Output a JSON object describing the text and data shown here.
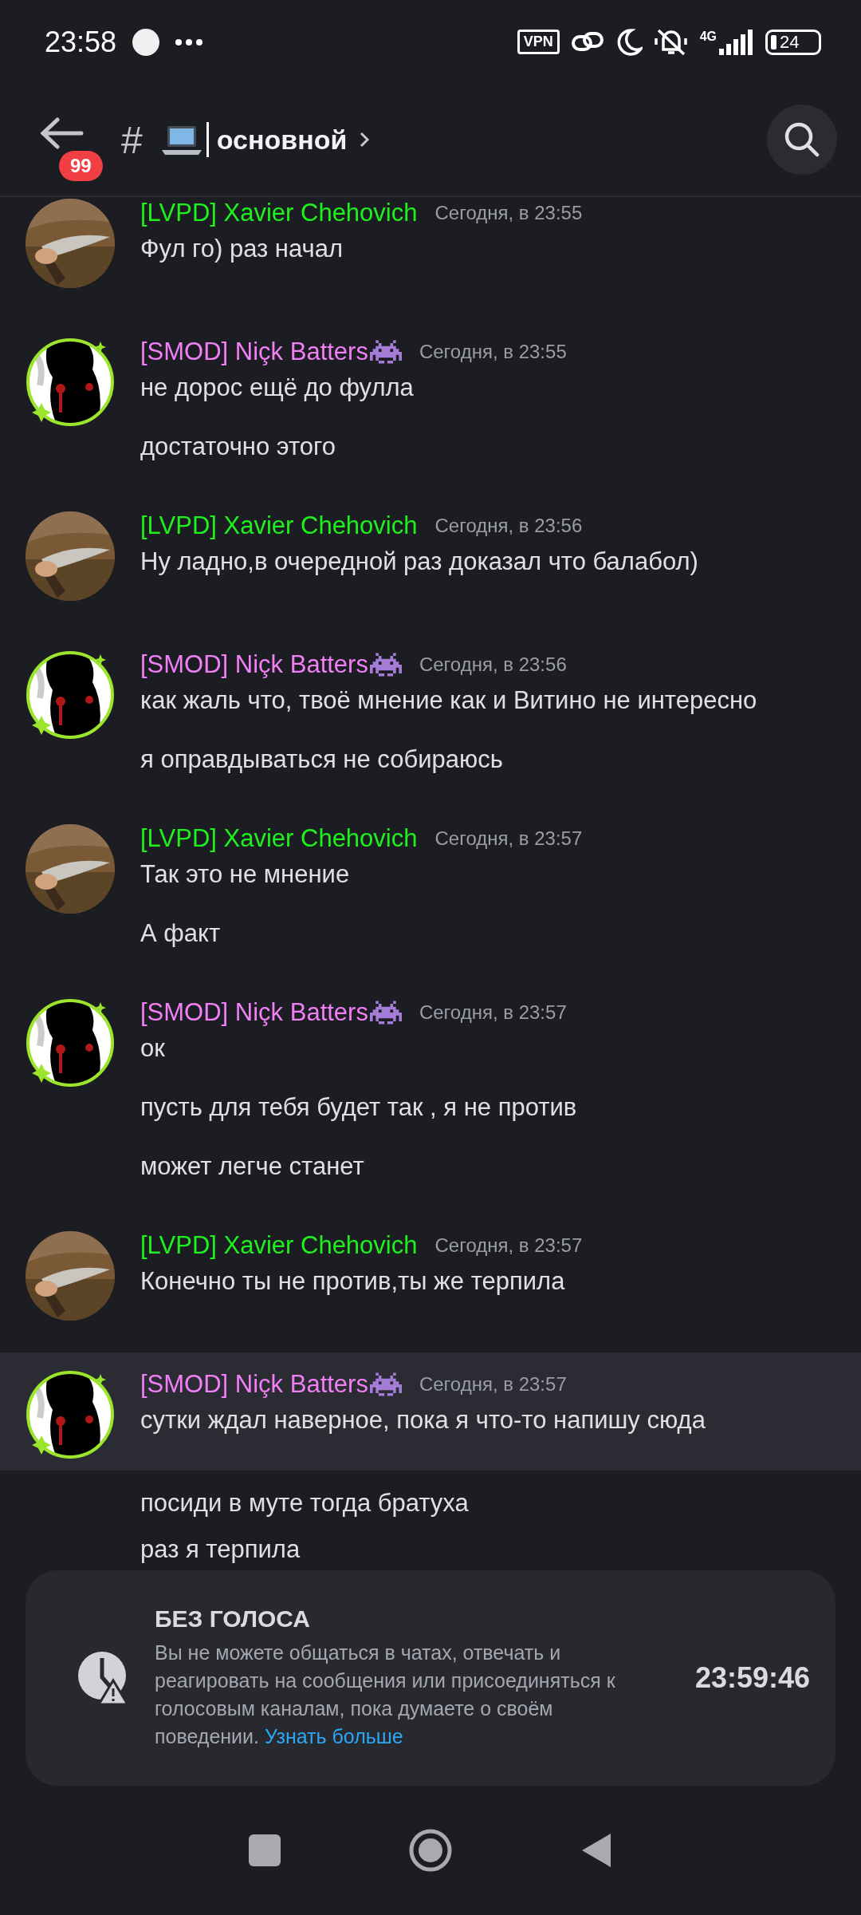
{
  "status_bar": {
    "time": "23:58",
    "vpn": "VPN",
    "network": "4G",
    "battery": "24"
  },
  "header": {
    "badge": "99",
    "hash": "#",
    "channel": "основной"
  },
  "messages": [
    {
      "kind": "member",
      "author": "[LVPD] Xavier Chehovich",
      "color": "#1df21d",
      "time": "Сегодня, в 23:55",
      "highlighted": false,
      "lines": [
        "Фул го) раз начал"
      ]
    },
    {
      "kind": "moderator",
      "author": "[SMOD] Niçk Batters",
      "color": "#f17ff5",
      "time": "Сегодня, в 23:55",
      "highlighted": false,
      "lines": [
        "не дорос ещё до фулла",
        "достаточно этого"
      ]
    },
    {
      "kind": "member",
      "author": "[LVPD] Xavier Chehovich",
      "color": "#1df21d",
      "time": "Сегодня, в 23:56",
      "highlighted": false,
      "lines": [
        "Ну ладно,в очередной раз доказал что балабол)"
      ]
    },
    {
      "kind": "moderator",
      "author": "[SMOD] Niçk Batters",
      "color": "#f17ff5",
      "time": "Сегодня, в 23:56",
      "highlighted": false,
      "lines": [
        "как жаль что, твоё мнение как и Витино не интересно",
        "я оправдываться не собираюсь"
      ]
    },
    {
      "kind": "member",
      "author": "[LVPD] Xavier Chehovich",
      "color": "#1df21d",
      "time": "Сегодня, в 23:57",
      "highlighted": false,
      "lines": [
        "Так это не мнение",
        "А факт"
      ]
    },
    {
      "kind": "moderator",
      "author": "[SMOD] Niçk Batters",
      "color": "#f17ff5",
      "time": "Сегодня, в 23:57",
      "highlighted": false,
      "lines": [
        "ок",
        "пусть для тебя будет так , я не против",
        "может легче станет"
      ]
    },
    {
      "kind": "member",
      "author": "[LVPD] Xavier Chehovich",
      "color": "#1df21d",
      "time": "Сегодня, в 23:57",
      "highlighted": false,
      "lines": [
        "Конечно ты не против,ты же терпила"
      ]
    },
    {
      "kind": "moderator",
      "author": "[SMOD] Niçk Batters",
      "color": "#f17ff5",
      "time": "Сегодня, в 23:57",
      "highlighted": true,
      "lines": [
        "сутки ждал наверное, пока я что-то напишу сюда",
        "посиди в муте тогда братуха",
        "раз я терпила"
      ]
    }
  ],
  "timeout_notice": {
    "title": "БЕЗ ГОЛОСА",
    "body": "Вы не можете общаться в чатах, отвечать и реагировать на сообщения или присоединяться к голосовым каналам, пока думаете о своём поведении.",
    "link": "Узнать больше",
    "countdown": "23:59:46"
  }
}
